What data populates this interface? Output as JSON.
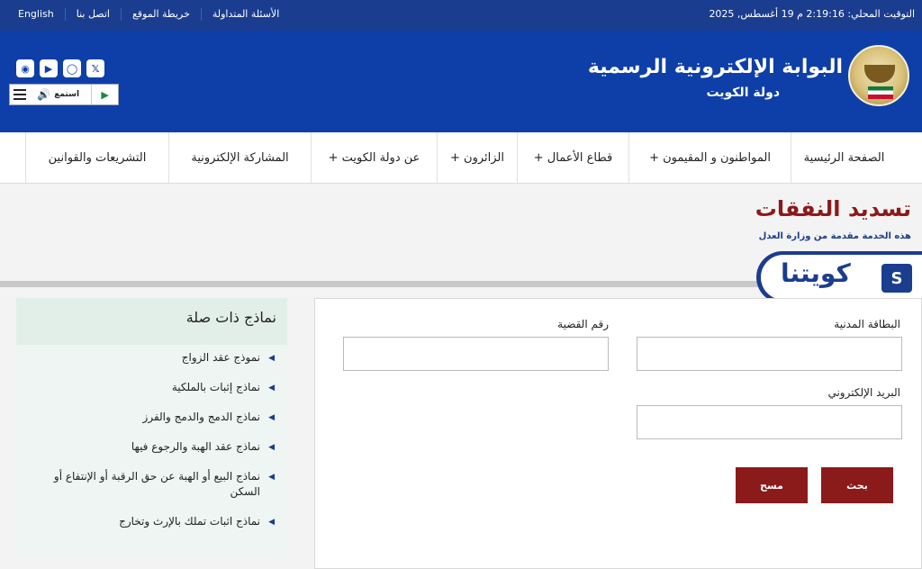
{
  "topbar": {
    "clock": "التوقيت المحلي: 2:19:16 م 19 أغسطس, 2025",
    "links": [
      "الأسئلة المتداولة",
      "خريطة الموقع",
      "اتصل بنا",
      "English"
    ]
  },
  "header": {
    "title": "البوابة الإلكترونية الرسمية",
    "subtitle": "دولة الكويت",
    "listen_label": "استمع",
    "social_icons": [
      "x-icon",
      "instagram-icon",
      "youtube-icon",
      "rss-icon"
    ]
  },
  "nav": {
    "items": [
      "الصفحة الرئيسية",
      "المواطنون و المقيمون +",
      "قطاع الأعمال +",
      "الزائرون +",
      "عن دولة الكويت +",
      "المشاركة الإلكترونية",
      "التشريعات والقوانين"
    ]
  },
  "page": {
    "title": "تسديد النفقات",
    "subtitle": "هذه الخدمة مقدمة من وزارة العدل"
  },
  "badge": {
    "text": "كويتنا",
    "icon": "S"
  },
  "form": {
    "civil_id_label": "البطاقة المدنية",
    "case_number_label": "رقم القضية",
    "email_label": "البريد الإلكتروني",
    "civil_id_value": "",
    "case_number_value": "",
    "email_value": "",
    "search_button": "بحث",
    "clear_button": "مسح"
  },
  "sidebar": {
    "title": "نماذج ذات صلة",
    "items": [
      "نموذج عقد الزواج",
      "نماذج إثبات بالملكية",
      "نماذج الدمج والدمج والفرز",
      "نماذج عقد الهبة والرجوع فيها",
      "نماذج البيع أو الهبة عن حق الرقبة أو الإنتفاع أو السكن",
      "نماذج اثبات تملك بالإرث وتخارج"
    ]
  },
  "colors": {
    "header_blue": "#0e3fa8",
    "topbar_blue": "#1a3d8f",
    "accent_red": "#8b1a1a"
  }
}
